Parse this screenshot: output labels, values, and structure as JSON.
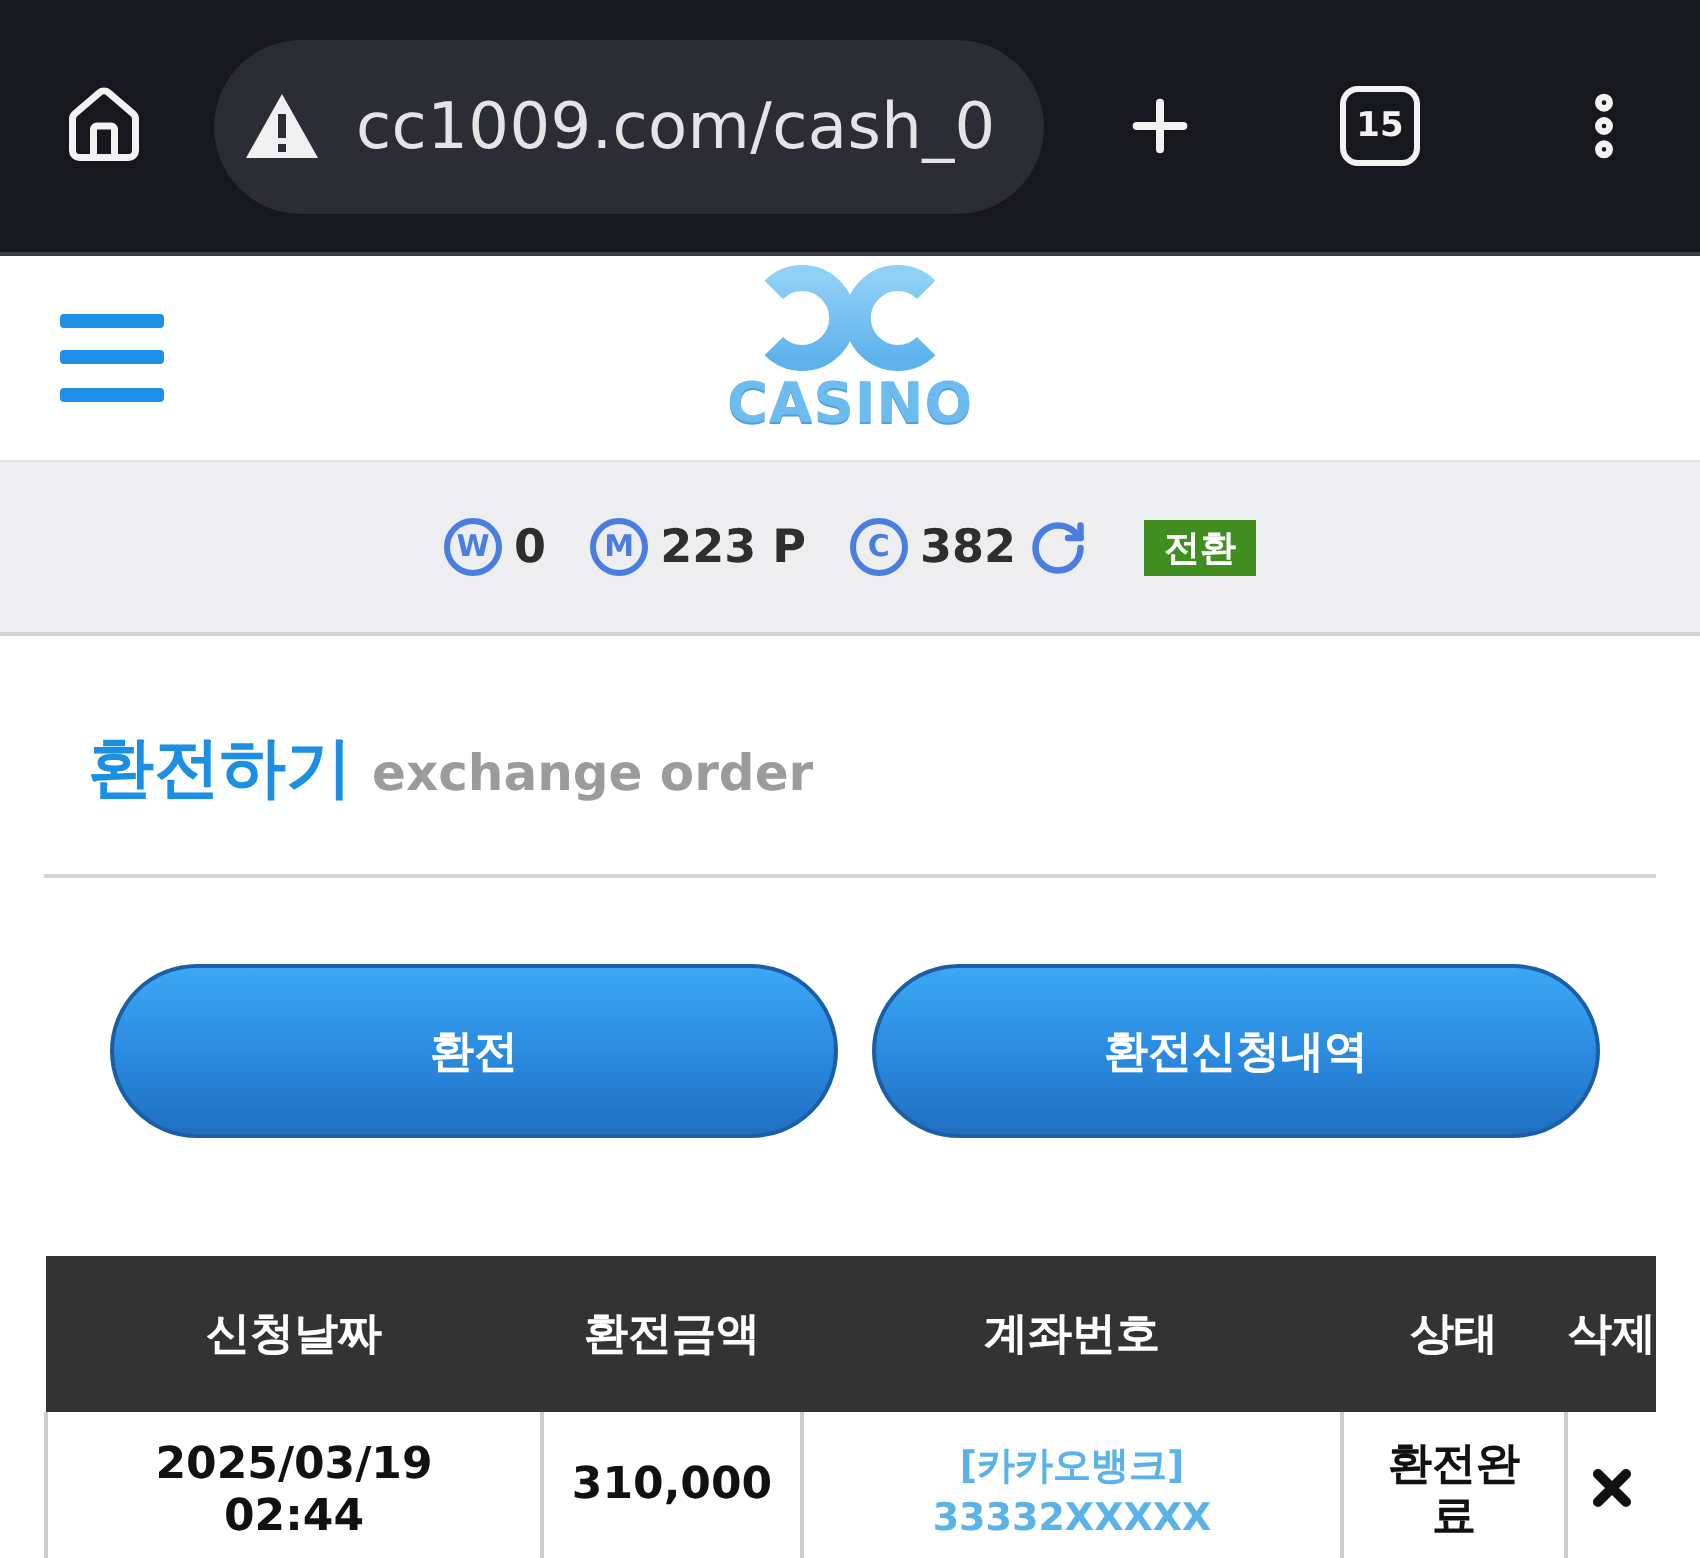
{
  "browser": {
    "url": "cc1009.com/cash_0",
    "tab_count": "15"
  },
  "header": {
    "logo_text": "CASINO"
  },
  "balances": [
    {
      "symbol": "W",
      "amount": "0",
      "refresh": false
    },
    {
      "symbol": "M",
      "amount": "223 P",
      "refresh": false
    },
    {
      "symbol": "C",
      "amount": "382",
      "refresh": true
    }
  ],
  "convert_button": "전환",
  "section": {
    "title": "환전하기",
    "subtitle": "exchange order"
  },
  "actions": [
    {
      "label": "환전"
    },
    {
      "label": "환전신청내역"
    }
  ],
  "table": {
    "columns": [
      "신청날짜",
      "환전금액",
      "계좌번호",
      "상태",
      "삭제"
    ],
    "rows": [
      {
        "date": "2025/03/19",
        "time": "02:44",
        "amount": "310,000",
        "bank": "[카카오뱅크]",
        "account": "33332XXXXX",
        "status": "환전완료"
      }
    ]
  }
}
